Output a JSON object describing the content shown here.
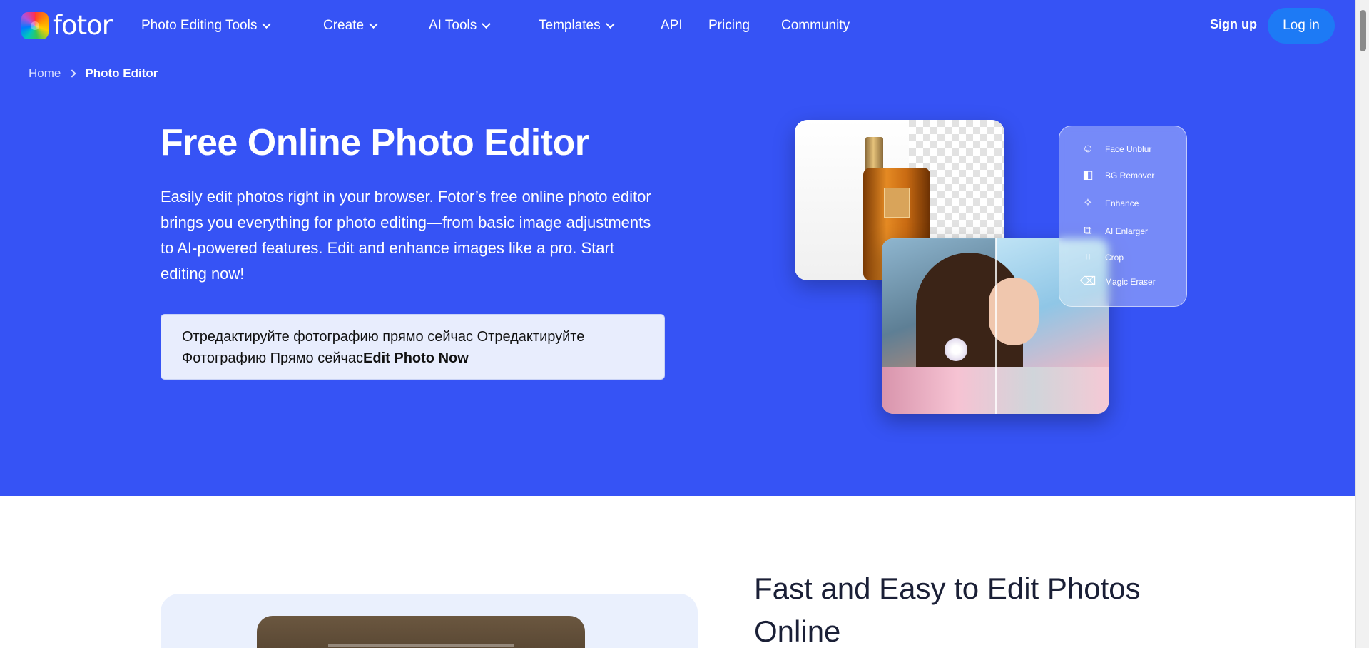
{
  "nav": {
    "logo_text": "fotor",
    "items": [
      {
        "label": "Photo Editing Tools",
        "has_dropdown": true
      },
      {
        "label": "Create",
        "has_dropdown": true
      },
      {
        "label": "AI Tools",
        "has_dropdown": true
      },
      {
        "label": "Templates",
        "has_dropdown": true
      },
      {
        "label": "API",
        "has_dropdown": false
      },
      {
        "label": "Pricing",
        "has_dropdown": false
      },
      {
        "label": "Community",
        "has_dropdown": false
      }
    ],
    "signup_label": "Sign up",
    "login_label": "Log in"
  },
  "breadcrumb": {
    "home": "Home",
    "current": "Photo Editor"
  },
  "hero": {
    "title": "Free Online Photo Editor",
    "description": "Easily edit photos right in your browser. Fotor’s free online photo editor brings you everything for photo editing—from basic image adjustments to AI-powered features. Edit and enhance images like a pro. Start editing now!",
    "cta_translated": "Отредактируйте фотографию прямо сейчас Отредактируйте Фотографию Прямо сейчас",
    "cta_label": "Edit Photo Now",
    "tools": [
      {
        "label": "Face Unblur",
        "icon": "smile-icon"
      },
      {
        "label": "BG Remover",
        "icon": "bg-remover-icon"
      },
      {
        "label": "Enhance",
        "icon": "sparkle-icon"
      },
      {
        "label": "AI Enlarger",
        "icon": "enlarge-icon"
      },
      {
        "label": "Crop",
        "icon": "crop-icon"
      },
      {
        "label": "Magic Eraser",
        "icon": "eraser-icon"
      }
    ]
  },
  "section": {
    "title": "Fast and Easy to Edit Photos Online"
  },
  "colors": {
    "hero_bg": "#3653f5",
    "login_bg": "#1d7af5",
    "cta_bg": "#e8edfd"
  }
}
